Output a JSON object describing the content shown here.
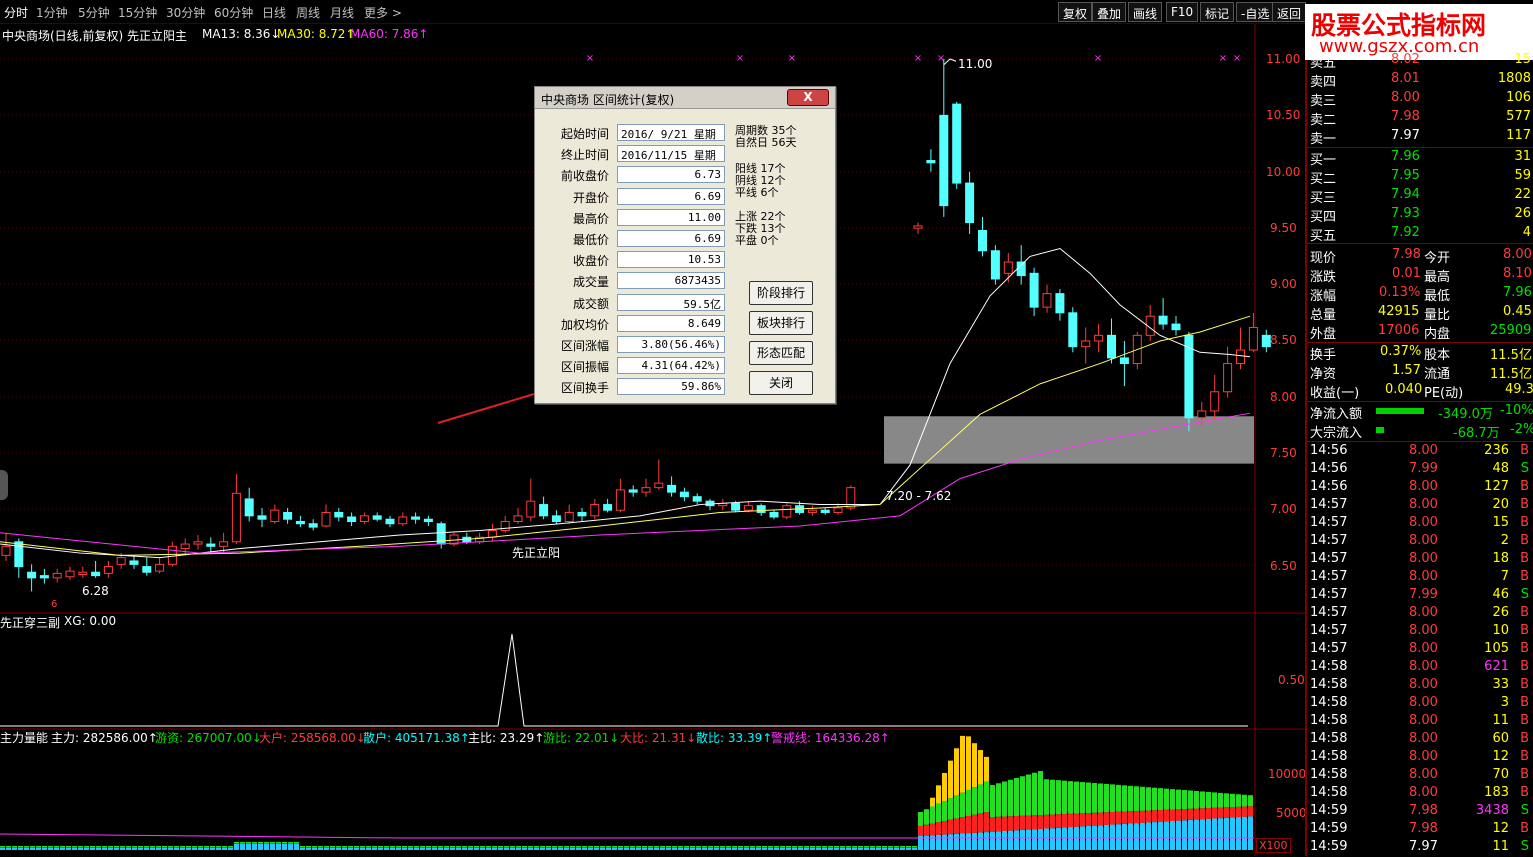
{
  "toolbar": {
    "periods": [
      "分时",
      "1分钟",
      "5分钟",
      "15分钟",
      "30分钟",
      "60分钟",
      "日线",
      "周线",
      "月线",
      "更多 >"
    ],
    "right_buttons": [
      "复权",
      "叠加",
      "画线",
      "F10",
      "标记",
      "-自选",
      "返回"
    ]
  },
  "logo": {
    "line1": "股票公式指标网",
    "line2": "www.gszx.com.cn"
  },
  "main_chart": {
    "title": "中央商场(日线,前复权) 先正立阳主",
    "ma13": "MA13: 8.36↓",
    "ma30": "MA30: 8.72↑",
    "ma60": "MA60: 7.86↑",
    "price_axis": [
      "11.00",
      "10.50",
      "10.00",
      "9.50",
      "9.00",
      "8.50",
      "8.00",
      "7.50",
      "7.00",
      "6.50"
    ],
    "high_label": "11.00",
    "low_label": "6.28",
    "zone_label": "7.20 - 7.62",
    "signal_label": "先正立阳",
    "low_marker": "6"
  },
  "indicator1": {
    "title": "先正穿三副",
    "xg": "XG: 0.00",
    "axis": [
      "0.50"
    ]
  },
  "indicator2": {
    "title": "主力量能",
    "zhuli": "主力: 282586.00↑",
    "youzi": "游资: 267007.00↓",
    "dahu": "大户: 258568.00↓",
    "sanhu": "散户: 405171.38↑",
    "zhubi": "主比: 23.29↑",
    "youbi": "游比: 22.01↓",
    "dabi": "大比: 21.31↓",
    "sanbi": "散比: 33.39↑",
    "jingjie": "警戒线: 164336.28↑",
    "axis": [
      "10000",
      "5000"
    ],
    "scale": "X100"
  },
  "dialog": {
    "title": "中央商场 区间统计(复权)",
    "close_btn": "X",
    "fields": [
      {
        "label": "起始时间",
        "value": "2016/ 9/21 星期"
      },
      {
        "label": "终止时间",
        "value": "2016/11/15 星期"
      },
      {
        "label": "前收盘价",
        "value": "6.73"
      },
      {
        "label": "开盘价",
        "value": "6.69"
      },
      {
        "label": "最高价",
        "value": "11.00"
      },
      {
        "label": "最低价",
        "value": "6.69"
      },
      {
        "label": "收盘价",
        "value": "10.53"
      },
      {
        "label": "成交量",
        "value": "6873435"
      },
      {
        "label": "成交额",
        "value": "59.5亿"
      },
      {
        "label": "加权均价",
        "value": "8.649"
      },
      {
        "label": "区间涨幅",
        "value": "3.80(56.46%)"
      },
      {
        "label": "区间振幅",
        "value": "4.31(64.42%)"
      },
      {
        "label": "区间换手",
        "value": "59.86%"
      }
    ],
    "stats": {
      "zhouqi": "周期数 35个",
      "ziran": "自然日 56天",
      "yang": "阳线 17个",
      "yin": "阴线 12个",
      "ping": "平线 6个",
      "shang": "上涨 22个",
      "xia": "下跌 13个",
      "pingpan": "平盘 0个"
    },
    "buttons": [
      "阶段排行",
      "板块排行",
      "形态匹配",
      "关闭"
    ]
  },
  "orderbook": {
    "sell": [
      {
        "label": "卖五",
        "price": "8.02",
        "vol": "15"
      },
      {
        "label": "卖四",
        "price": "8.01",
        "vol": "1808"
      },
      {
        "label": "卖三",
        "price": "8.00",
        "vol": "106"
      },
      {
        "label": "卖二",
        "price": "7.98",
        "vol": "577"
      },
      {
        "label": "卖一",
        "price": "7.97",
        "vol": "117"
      }
    ],
    "buy": [
      {
        "label": "买一",
        "price": "7.96",
        "vol": "31"
      },
      {
        "label": "买二",
        "price": "7.95",
        "vol": "59"
      },
      {
        "label": "买三",
        "price": "7.94",
        "vol": "22"
      },
      {
        "label": "买四",
        "price": "7.93",
        "vol": "26"
      },
      {
        "label": "买五",
        "price": "7.92",
        "vol": "4"
      }
    ]
  },
  "quote": {
    "xianjia": "现价",
    "xianjia_v": "7.98",
    "jinkai": "今开",
    "jinkai_v": "8.00",
    "zhangdie": "涨跌",
    "zhangdie_v": "0.01",
    "zuigao": "最高",
    "zuigao_v": "8.10",
    "zhangfu": "涨幅",
    "zhangfu_v": "0.13%",
    "zuidi": "最低",
    "zuidi_v": "7.96",
    "zongliang": "总量",
    "zongliang_v": "42915",
    "liangbi": "量比",
    "liangbi_v": "0.45",
    "waipan": "外盘",
    "waipan_v": "17006",
    "neipan": "内盘",
    "neipan_v": "25909",
    "huanshou": "换手",
    "huanshou_v": "0.37%",
    "guben": "股本",
    "guben_v": "11.5亿",
    "jingzi": "净资",
    "jingzi_v": "1.57",
    "liutong": "流通",
    "liutong_v": "11.5亿",
    "shouyi": "收益(一)",
    "shouyi_v": "0.040",
    "pe": "PE(动)",
    "pe_v": "49.3",
    "jingliuru": "净流入额",
    "jingliuru_v": "-349.0万",
    "jingliuru_p": "-10%",
    "dazong": "大宗流入",
    "dazong_v": "-68.7万",
    "dazong_p": "-2%"
  },
  "ticks": [
    {
      "t": "14:56",
      "p": "8.00",
      "v": "236",
      "d": "B"
    },
    {
      "t": "14:56",
      "p": "7.99",
      "v": "48",
      "d": "S"
    },
    {
      "t": "14:56",
      "p": "8.00",
      "v": "127",
      "d": "B"
    },
    {
      "t": "14:57",
      "p": "8.00",
      "v": "20",
      "d": "B"
    },
    {
      "t": "14:57",
      "p": "8.00",
      "v": "15",
      "d": "B"
    },
    {
      "t": "14:57",
      "p": "8.00",
      "v": "2",
      "d": "B"
    },
    {
      "t": "14:57",
      "p": "8.00",
      "v": "18",
      "d": "B"
    },
    {
      "t": "14:57",
      "p": "8.00",
      "v": "7",
      "d": "B"
    },
    {
      "t": "14:57",
      "p": "7.99",
      "v": "46",
      "d": "S"
    },
    {
      "t": "14:57",
      "p": "8.00",
      "v": "26",
      "d": "B"
    },
    {
      "t": "14:57",
      "p": "8.00",
      "v": "10",
      "d": "B"
    },
    {
      "t": "14:57",
      "p": "8.00",
      "v": "105",
      "d": "B"
    },
    {
      "t": "14:58",
      "p": "8.00",
      "v": "621",
      "d": "B"
    },
    {
      "t": "14:58",
      "p": "8.00",
      "v": "33",
      "d": "B"
    },
    {
      "t": "14:58",
      "p": "8.00",
      "v": "3",
      "d": "B"
    },
    {
      "t": "14:58",
      "p": "8.00",
      "v": "11",
      "d": "B"
    },
    {
      "t": "14:58",
      "p": "8.00",
      "v": "60",
      "d": "B"
    },
    {
      "t": "14:58",
      "p": "8.00",
      "v": "12",
      "d": "B"
    },
    {
      "t": "14:58",
      "p": "8.00",
      "v": "70",
      "d": "B"
    },
    {
      "t": "14:58",
      "p": "8.00",
      "v": "183",
      "d": "B"
    },
    {
      "t": "14:59",
      "p": "7.98",
      "v": "3438",
      "d": "S"
    },
    {
      "t": "14:59",
      "p": "7.98",
      "v": "12",
      "d": "B"
    },
    {
      "t": "14:59",
      "p": "7.97",
      "v": "11",
      "d": "S"
    }
  ],
  "colors": {
    "up": "#ff3b3b",
    "down": "#54ffff",
    "ma13": "#ffffff",
    "ma30": "#ffff66",
    "ma60": "#ff33ff",
    "grid": "#800000"
  }
}
